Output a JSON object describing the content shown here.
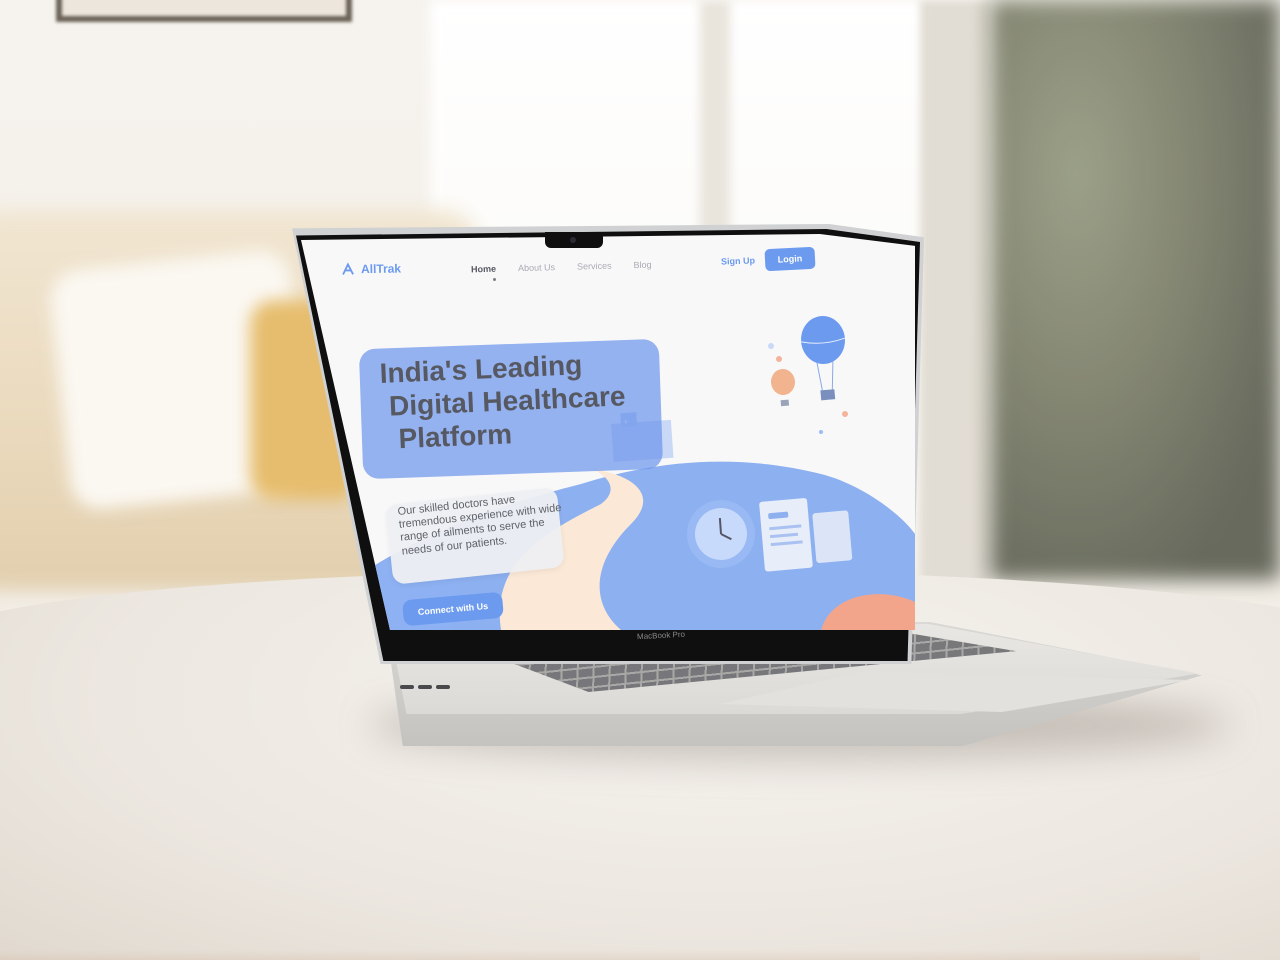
{
  "site": {
    "logo": "AllTrak",
    "nav": [
      "Home",
      "About Us",
      "Services",
      "Blog"
    ],
    "active_nav": "Home",
    "signup_label": "Sign Up",
    "login_label": "Login",
    "hero": {
      "title_lines": [
        "India's Leading",
        "Digital Healthcare",
        "Platform"
      ],
      "description": "Our skilled doctors have tremendous experience with wide range of ailments to serve the needs of our patients.",
      "cta_label": "Connect with Us"
    }
  },
  "device": {
    "model_label": "MacBook Pro"
  },
  "colors": {
    "accent": "#6b9aef",
    "hero_box": "#6e96eb",
    "title_text": "#575962"
  },
  "icons": [
    "logo-icon",
    "balloon-icon",
    "clock-icon",
    "document-icon"
  ]
}
